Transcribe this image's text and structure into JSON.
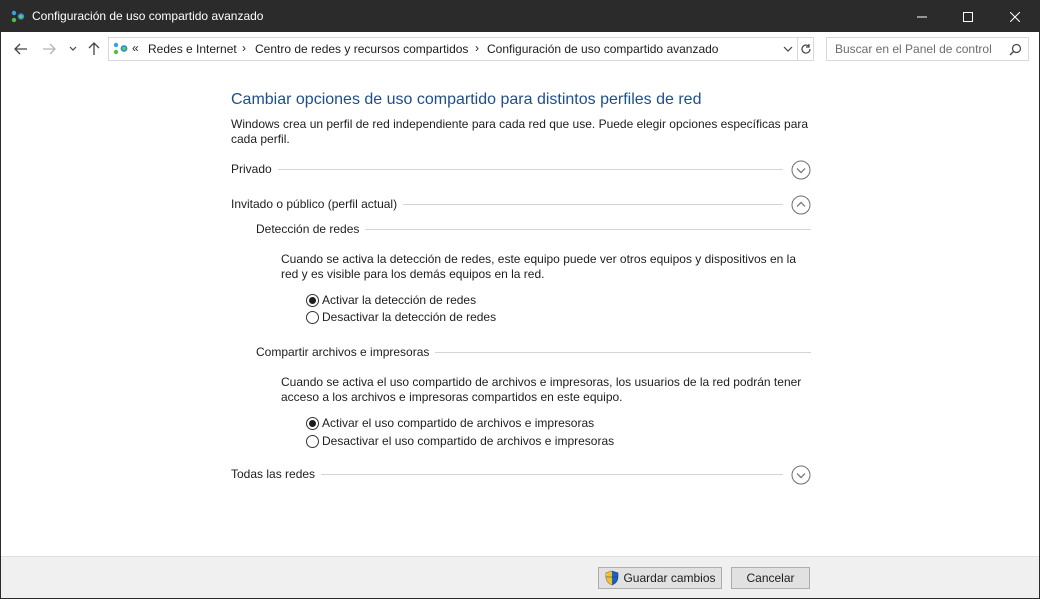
{
  "window": {
    "title": "Configuración de uso compartido avanzado"
  },
  "address": {
    "overflow": "«",
    "crumbs": [
      "Redes e Internet",
      "Centro de redes y recursos compartidos",
      "Configuración de uso compartido avanzado"
    ],
    "separator": "›"
  },
  "search": {
    "placeholder": "Buscar en el Panel de control"
  },
  "main": {
    "title": "Cambiar opciones de uso compartido para distintos perfiles de red",
    "description": "Windows crea un perfil de red independiente para cada red que use. Puede elegir opciones específicas para cada perfil.",
    "sections": {
      "private": {
        "label": "Privado",
        "expanded": false
      },
      "guest": {
        "label": "Invitado o público (perfil actual)",
        "expanded": true
      },
      "all": {
        "label": "Todas las redes",
        "expanded": false
      }
    },
    "network_discovery": {
      "heading": "Detección de redes",
      "description": "Cuando se activa la detección de redes, este equipo puede ver otros equipos y dispositivos en la red y es visible para los demás equipos en la red.",
      "on_label": "Activar la detección de redes",
      "off_label": "Desactivar la detección de redes",
      "selected": "on"
    },
    "file_sharing": {
      "heading": "Compartir archivos e impresoras",
      "description": "Cuando se activa el uso compartido de archivos e impresoras, los usuarios de la red podrán tener acceso a los archivos e impresoras compartidos en este equipo.",
      "on_label": "Activar el uso compartido de archivos e impresoras",
      "off_label": "Desactivar el uso compartido de archivos e impresoras",
      "selected": "on"
    }
  },
  "footer": {
    "save_label": "Guardar cambios",
    "cancel_label": "Cancelar"
  },
  "colors": {
    "titlebar": "#2b2b2b",
    "heading": "#1e4e8c",
    "footer": "#f0f0f0"
  }
}
